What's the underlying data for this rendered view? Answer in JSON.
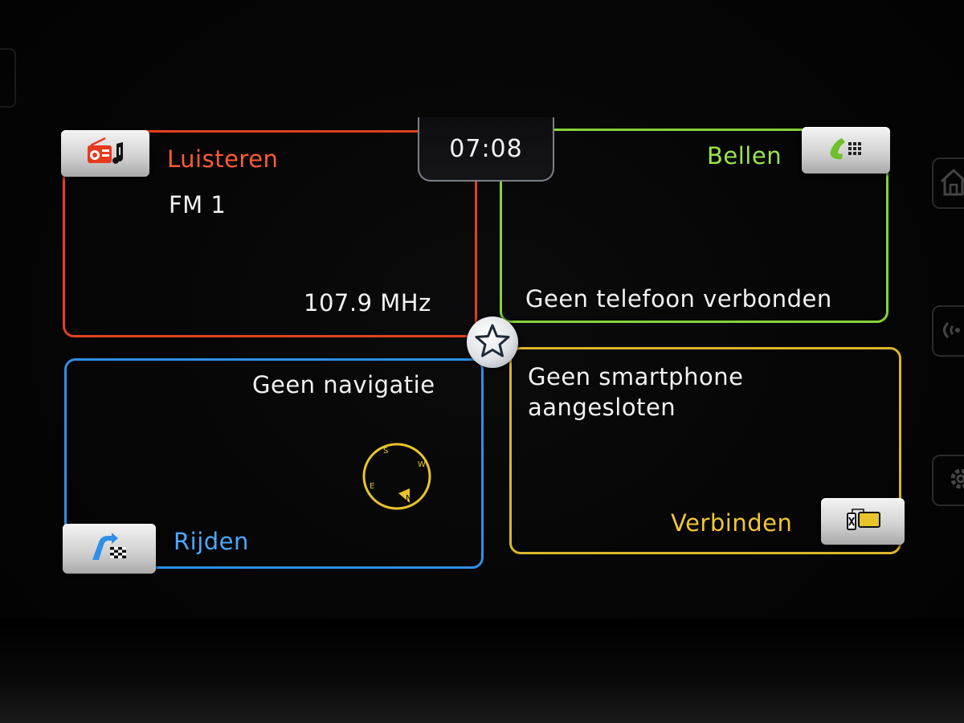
{
  "clock": "07:08",
  "listen": {
    "title": "Luisteren",
    "source": "FM 1",
    "frequency": "107.9  MHz",
    "icon": "radio-music-icon",
    "color": "#e0421f"
  },
  "call": {
    "title": "Bellen",
    "status": "Geen telefoon verbonden",
    "icon": "phone-keypad-icon",
    "color": "#86d23a"
  },
  "navigation": {
    "title": "Rijden",
    "status": "Geen navigatie",
    "icon": "route-flag-icon",
    "compass": {
      "s": "S",
      "w": "W",
      "e": "E",
      "n": "N"
    },
    "color": "#2f8fe6"
  },
  "smartphone": {
    "status_line1": "Geen smartphone",
    "status_line2": "aangesloten",
    "action": "Verbinden",
    "icon": "device-connect-icon",
    "color": "#d9b52c"
  },
  "favorite_icon": "star-icon",
  "side_icons": [
    "home-icon",
    "wireless-icon",
    "settings-icon"
  ]
}
